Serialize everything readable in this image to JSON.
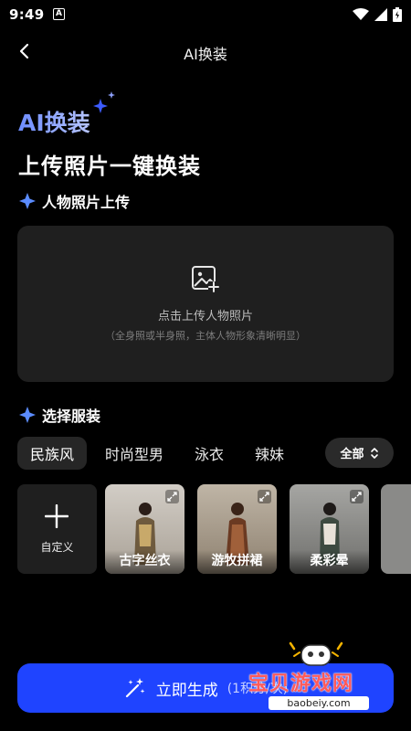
{
  "status_bar": {
    "time": "9:49",
    "notification_icon": "A"
  },
  "nav": {
    "title": "AI换装"
  },
  "hero": {
    "ai_title": "AI换装",
    "subtitle": "上传照片一键换装"
  },
  "upload_section": {
    "heading": "人物照片上传",
    "prompt": "点击上传人物照片",
    "hint": "（全身照或半身照，主体人物形象清晰明显）"
  },
  "clothing_section": {
    "heading": "选择服装",
    "tabs": [
      "民族风",
      "时尚型男",
      "泳衣",
      "辣妹"
    ],
    "active_tab": "民族风",
    "filter_label": "全部",
    "custom_label": "自定义",
    "items": [
      {
        "label": "古字丝衣",
        "bg": "#b9b2a8"
      },
      {
        "label": "游牧拼裙",
        "bg": "#a89a88"
      },
      {
        "label": "柔彩晕",
        "bg": "#8f8f8c"
      }
    ]
  },
  "generate": {
    "label": "立即生成",
    "cost": "(1积分/次)"
  },
  "watermark": {
    "text": "宝贝游戏网",
    "url": "baobeiy.com"
  },
  "colors": {
    "accent": "#1f44ff",
    "card_bg": "#1f1f1f",
    "background": "#000000"
  }
}
